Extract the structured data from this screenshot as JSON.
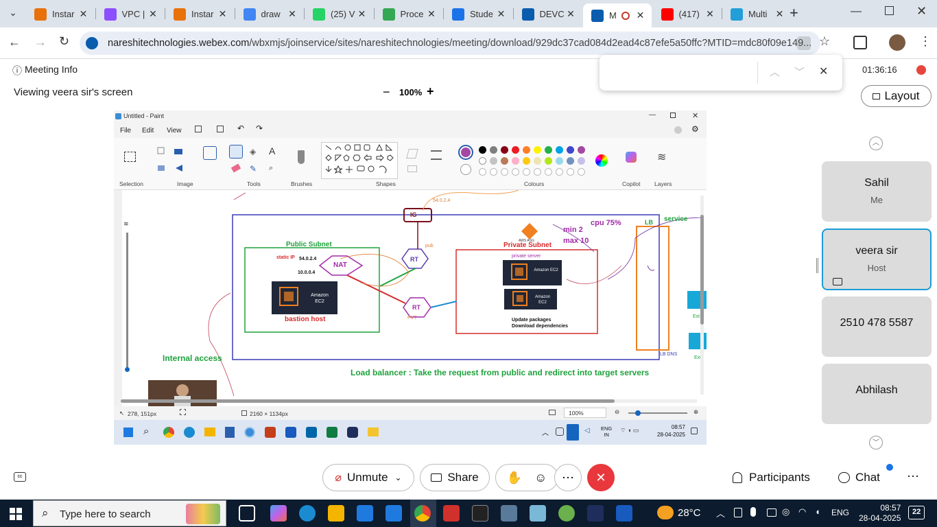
{
  "browser": {
    "tabs": [
      {
        "label": "Instar",
        "icon": "instance-icon",
        "color": "#e8710a"
      },
      {
        "label": "VPC |",
        "icon": "vpc-icon",
        "color": "#8c4fff"
      },
      {
        "label": "Instar",
        "icon": "instance-icon",
        "color": "#e8710a"
      },
      {
        "label": "draw",
        "icon": "google-icon",
        "color": "#4285f4"
      },
      {
        "label": "(25) V",
        "icon": "whatsapp-icon",
        "color": "#25d366"
      },
      {
        "label": "Proce",
        "icon": "google-drive-icon",
        "color": "#34a853"
      },
      {
        "label": "Stude",
        "icon": "student-icon",
        "color": "#1a73e8"
      },
      {
        "label": "DEVC",
        "icon": "webex-icon",
        "color": "#0a5cad"
      },
      {
        "label": "M",
        "icon": "webex-icon",
        "color": "#0a5cad",
        "active": true
      },
      {
        "label": "(417)",
        "icon": "youtube-icon",
        "color": "#ff0000"
      },
      {
        "label": "Multi",
        "icon": "telegram-icon",
        "color": "#229ed9"
      }
    ],
    "url_host": "nareshitechnologies.webex.com",
    "url_path": "/wbxmjs/joinservice/sites/nareshitechnologies/meeting/download/929dc37cad084d2ead4c87efe5a50ffc?MTID=mdc80f09e149..."
  },
  "webex": {
    "meeting_info": "Meeting Info",
    "viewing": "Viewing veera sir's screen",
    "zoom": "100%",
    "timer": "01:36:16",
    "layout": "Layout",
    "participants_cards": [
      {
        "name": "Sahil",
        "role": "Me"
      },
      {
        "name": "veera sir",
        "role": "Host"
      },
      {
        "name": "2510 478 5587",
        "role": ""
      },
      {
        "name": "Abhilash",
        "role": ""
      }
    ],
    "controls": {
      "unmute": "Unmute",
      "share": "Share",
      "participants": "Participants",
      "chat": "Chat"
    }
  },
  "paint": {
    "title": "Untitled - Paint",
    "menu": [
      "File",
      "Edit",
      "View"
    ],
    "ribbon_groups": [
      "Selection",
      "Image",
      "Tools",
      "Brushes",
      "Shapes",
      "Colours",
      "Copilot",
      "Layers"
    ],
    "status_pos": "278, 151px",
    "status_size": "2160 × 1134px",
    "status_zoom": "100%",
    "palette": [
      "#000000",
      "#7f7f7f",
      "#880015",
      "#ed1c24",
      "#ff7f27",
      "#fff200",
      "#22b14c",
      "#00a2e8",
      "#3f48cc",
      "#a349a4",
      "#ffffff",
      "#c3c3c3",
      "#b97a57",
      "#ffaec9",
      "#ffc90e",
      "#efe4b0",
      "#b5e61d",
      "#99d9ea",
      "#7092be",
      "#c8bfe7"
    ],
    "primary_color": "#a349a4"
  },
  "diagram": {
    "public_subnet": "Public Subnet",
    "static_ip": "static IP",
    "ip1": "54.0.2.4",
    "ip2": "10.0.0.4",
    "ec2": "Amazon EC2",
    "bastion": "bastion host",
    "nat": "NAT",
    "ig": "IG",
    "rt": "RT",
    "pub": "pub",
    "pvt": "PVT",
    "top_ip": "54.0.2.4",
    "private_subnet": "Private Subnet",
    "private_server": "private server",
    "asg_label": "AWS ASG",
    "min": "min 2",
    "max": "max 10",
    "cpu": "cpu 75%",
    "lb": "LB",
    "service": "service",
    "update1": "Update packages",
    "update2": "Download dependencies",
    "internal": "Internal access",
    "lb_dns": "LB DNS",
    "ext": "Ext",
    "lb_note": "Load balancer :  Take the request from public and redirect into target servers"
  },
  "inner_taskbar": {
    "lang1": "ENG",
    "lang2": "IN",
    "time": "08:57",
    "date": "28-04-2025"
  },
  "taskbar": {
    "search_placeholder": "Type here to search",
    "weather": "28°C",
    "lang": "ENG",
    "time": "08:57",
    "date": "28-04-2025",
    "notifications": "22"
  }
}
